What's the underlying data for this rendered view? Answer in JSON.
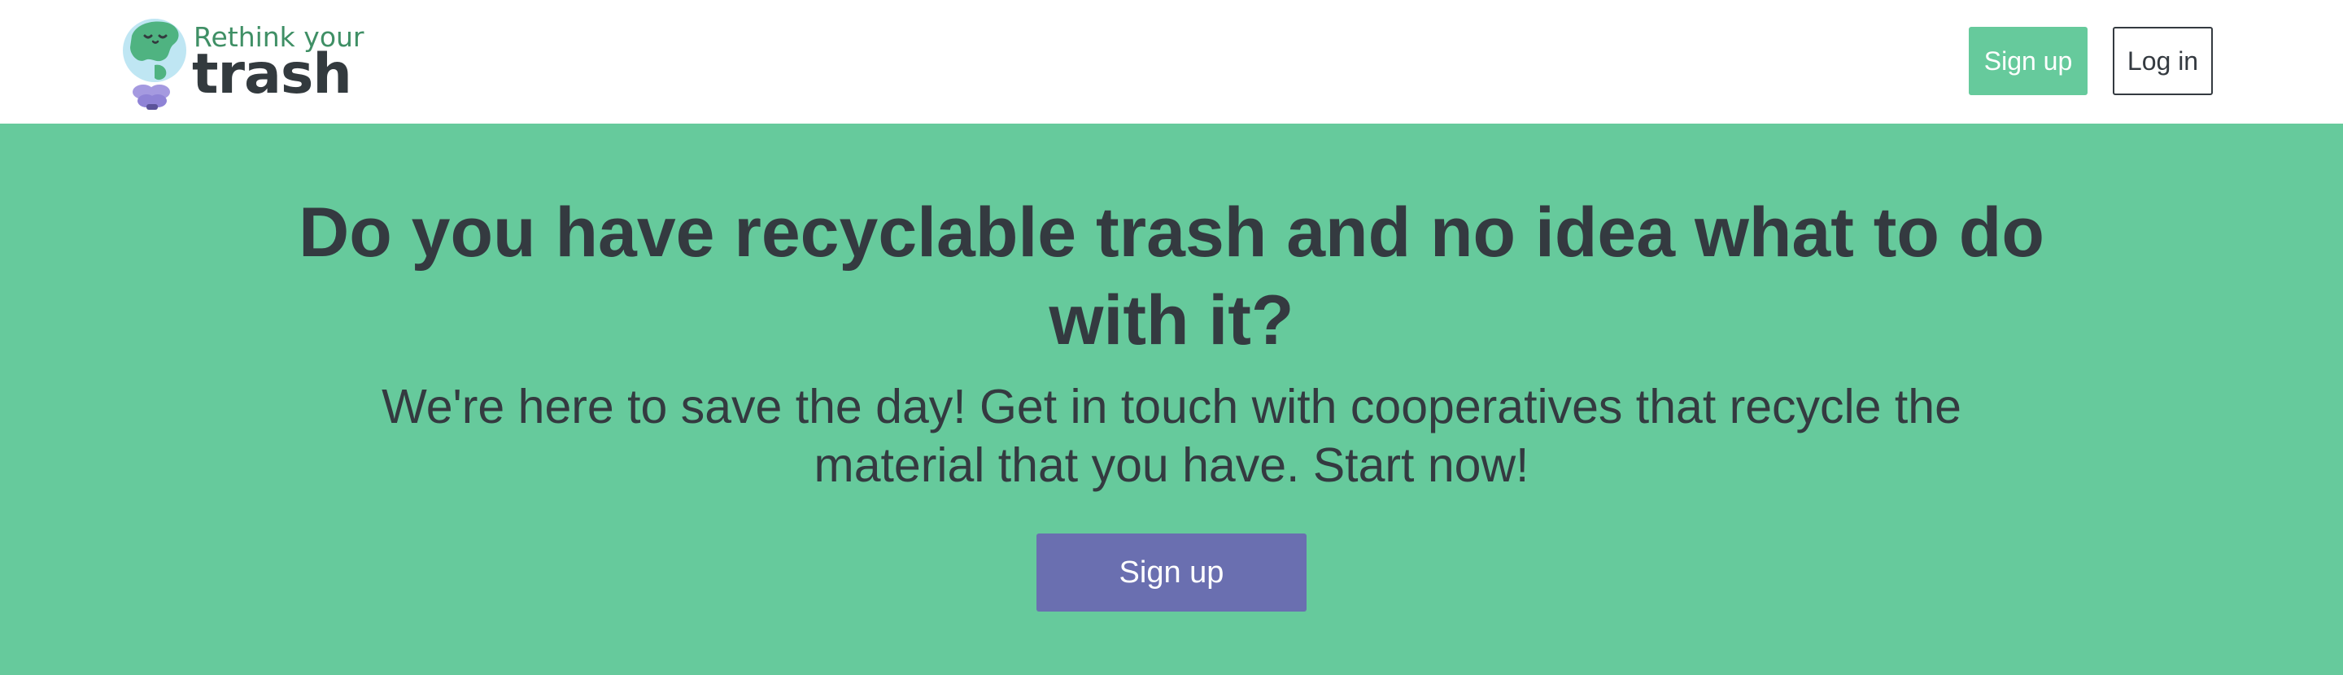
{
  "navbar": {
    "logo": {
      "line1": "Rethink your",
      "line2": "trash",
      "icon": "earth-lightbulb-icon"
    },
    "signup_label": "Sign up",
    "login_label": "Log in"
  },
  "hero": {
    "title": "Do you have recyclable trash and no idea what to do with it?",
    "subtitle": "We're here to save the day! Get in touch with cooperatives that recycle the material that you have. Start now!",
    "cta_label": "Sign up"
  },
  "colors": {
    "primary_green": "#66ca9c",
    "accent_purple": "#6a6fb0",
    "text_dark": "#343a40",
    "logo_green": "#3f8f65"
  }
}
